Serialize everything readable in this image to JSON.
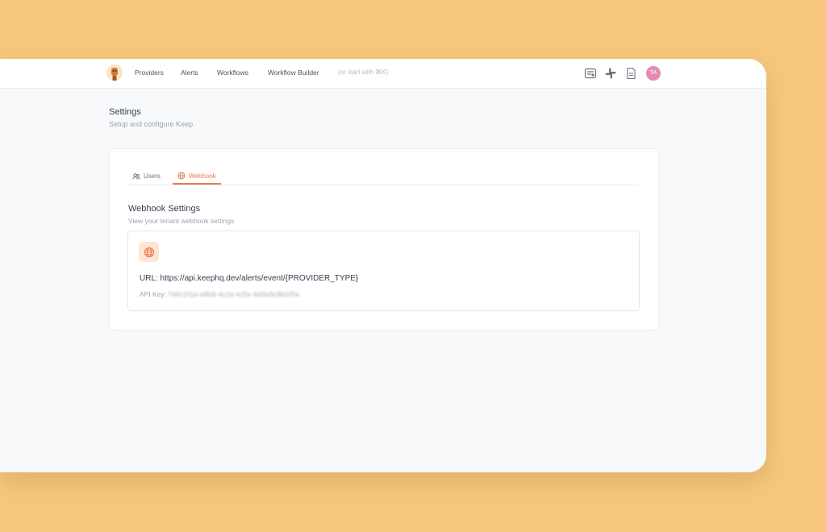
{
  "navbar": {
    "items": [
      {
        "label": "Providers"
      },
      {
        "label": "Alerts"
      },
      {
        "label": "Workflows"
      },
      {
        "label": "Workflow Builder"
      }
    ],
    "command_hint": "(or start with ⌘K)",
    "icons": [
      "keep-logo-icon",
      "keep-icon",
      "slack-icon",
      "docs-icon"
    ],
    "avatar_initials": "TA",
    "avatar_color": "#e58bb1"
  },
  "page": {
    "title": "Settings",
    "subtitle": "Setup and configure Keep"
  },
  "tabs": [
    {
      "label": "Users",
      "icon": "users-icon",
      "active": false
    },
    {
      "label": "Webhook",
      "icon": "globe-icon",
      "active": true
    }
  ],
  "webhook": {
    "title": "Webhook Settings",
    "subtitle": "View your tenant webhook settings",
    "url_text": "URL: https://api.keephq.dev/alerts/event/{PROVIDER_TYPE}",
    "api_key_label": "API Key:",
    "api_key_value": "7d4c2f1a-e8b9-4c1e-b2fa-6d3e9c8b1f0a"
  },
  "colors": {
    "accent": "#ea7d48",
    "background": "#f6c77c",
    "page": "#f8f9fb"
  }
}
